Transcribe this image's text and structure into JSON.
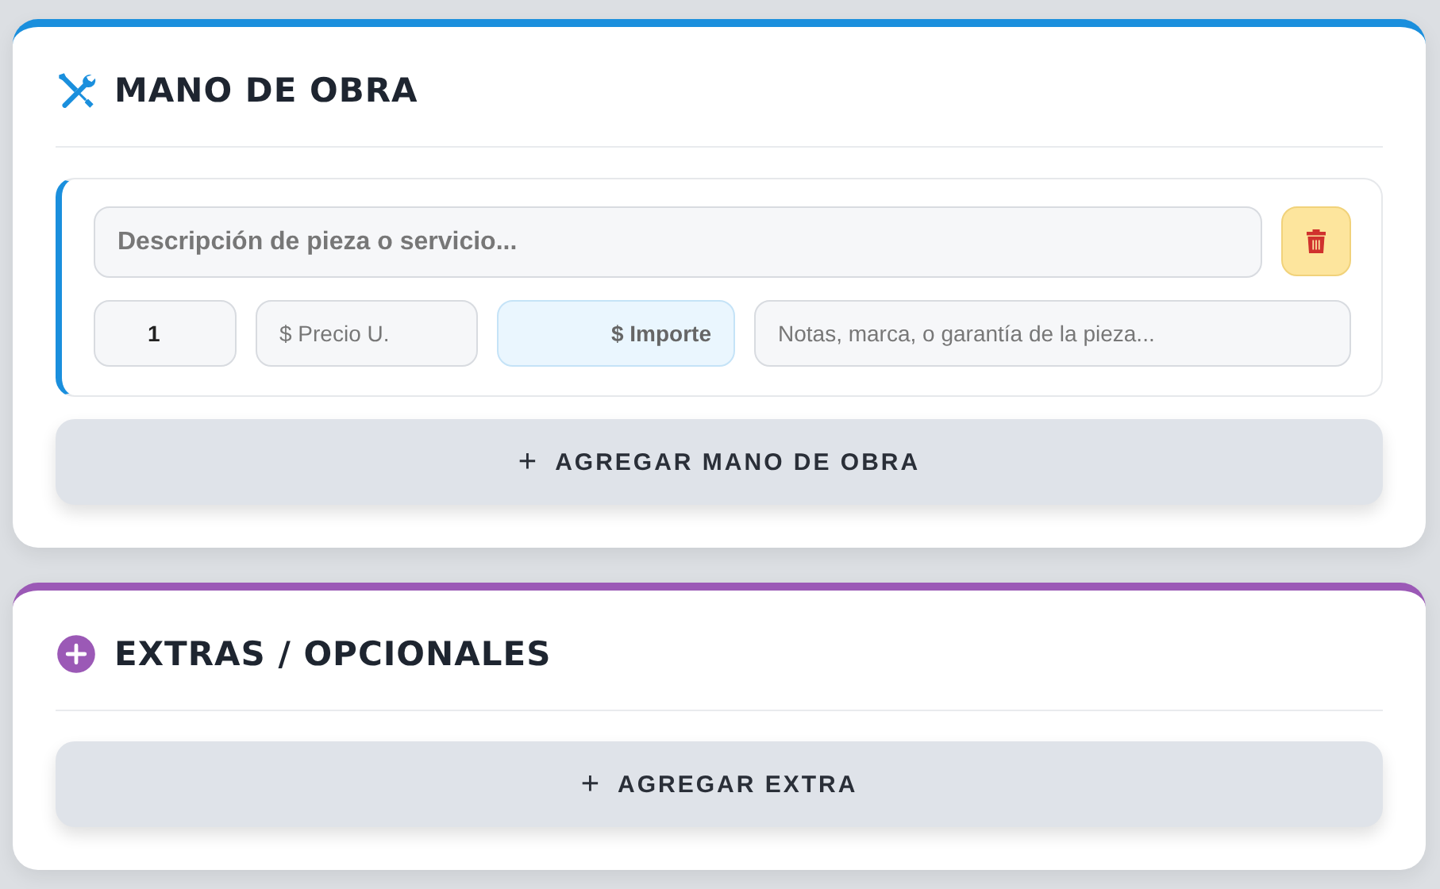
{
  "sections": [
    {
      "kind": "labor",
      "color": "#1a8fdd",
      "title": "MANO DE OBRA",
      "items": [
        {
          "description": {
            "placeholder": "Descripción de pieza o servicio..."
          },
          "quantity": {
            "value": "1"
          },
          "unit_price": {
            "placeholder": "$ Precio U."
          },
          "amount": {
            "placeholder": "$ Importe"
          },
          "notes": {
            "placeholder": "Notas, marca, o garantía de la pieza..."
          }
        }
      ],
      "add_button": {
        "icon": "+",
        "label": "AGREGAR MANO DE OBRA"
      }
    },
    {
      "kind": "extras",
      "color": "#9b59b6",
      "title": "EXTRAS / OPCIONALES",
      "add_button": {
        "icon": "+",
        "label": "AGREGAR EXTRA"
      }
    }
  ]
}
